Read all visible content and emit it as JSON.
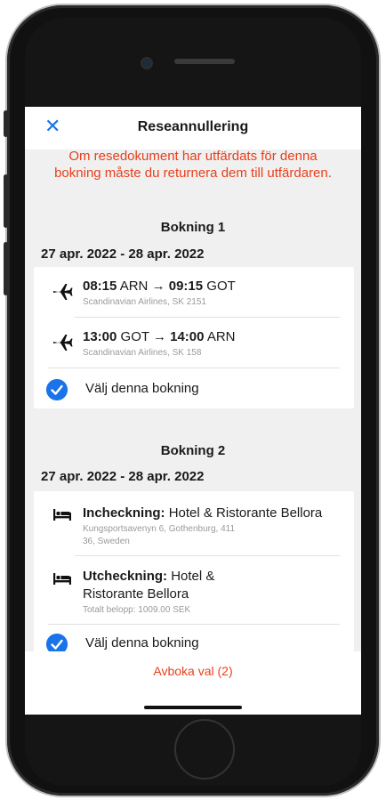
{
  "header": {
    "title": "Reseannullering",
    "close_icon": "close-icon"
  },
  "warning": "Om resedokument har utfärdats för denna bokning måste du returnera dem till utfärdaren.",
  "bookings": [
    {
      "title": "Bokning 1",
      "date_range": "27 apr. 2022 - 28 apr. 2022",
      "items": [
        {
          "icon": "airplane-icon",
          "time1": "08:15",
          "code1": "ARN",
          "arrow": "→",
          "time2": "09:15",
          "code2": "GOT",
          "sub": "Scandinavian Airlines, SK 2151"
        },
        {
          "icon": "airplane-icon",
          "time1": "13:00",
          "code1": "GOT",
          "arrow": "→",
          "time2": "14:00",
          "code2": "ARN",
          "sub": "Scandinavian Airlines, SK 158"
        }
      ],
      "select_label": "Välj denna bokning"
    },
    {
      "title": "Bokning 2",
      "date_range": "27 apr. 2022 - 28 apr. 2022",
      "items": [
        {
          "icon": "bed-icon",
          "label": "Incheckning:",
          "value": "Hotel & Ristorante Bellora",
          "sub_line1": "Kungsportsavenyn 6, Gothenburg, 411",
          "sub_line2": "36, Sweden"
        },
        {
          "icon": "bed-icon",
          "label": "Utcheckning:",
          "value_line1": "Hotel &",
          "value_line2": "Ristorante Bellora",
          "sub": "Totalt belopp: 1009.00 SEK"
        }
      ],
      "select_label": "Välj denna bokning"
    }
  ],
  "footer": {
    "cancel_label": "Avboka val (2)"
  },
  "colors": {
    "accent": "#1a73e8",
    "warning": "#e8401c"
  }
}
